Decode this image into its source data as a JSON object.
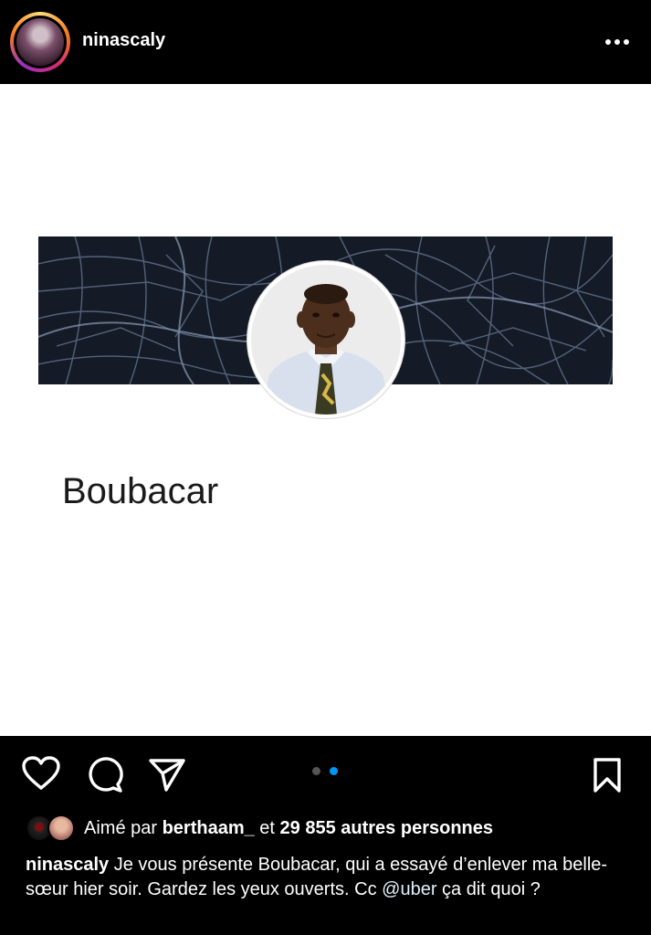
{
  "header": {
    "username": "ninascaly",
    "more_icon": "more-horizontal-icon"
  },
  "post": {
    "driver_name": "Boubacar",
    "carousel": {
      "count": 2,
      "active": 2,
      "active_color": "#0095f6",
      "inactive_color": "#555555"
    }
  },
  "actions": {
    "icons": [
      "heart-icon",
      "comment-icon",
      "share-icon",
      "bookmark-icon"
    ]
  },
  "likes": {
    "prefix": "Aimé par ",
    "user": "berthaam_",
    "middle": " et ",
    "count": "29 855 autres personnes"
  },
  "caption": {
    "username": "ninascaly",
    "text_before": " Je vous présente Boubacar, qui a essayé d’enlever ma belle-sœur hier soir. Gardez les yeux ouverts. Cc ",
    "mention": "@uber",
    "text_after": " ça dit quoi ?"
  },
  "colors": {
    "background": "#000000",
    "post_background": "#ffffff",
    "map_background": "#141b26",
    "map_streets": "#5e6f8a"
  }
}
